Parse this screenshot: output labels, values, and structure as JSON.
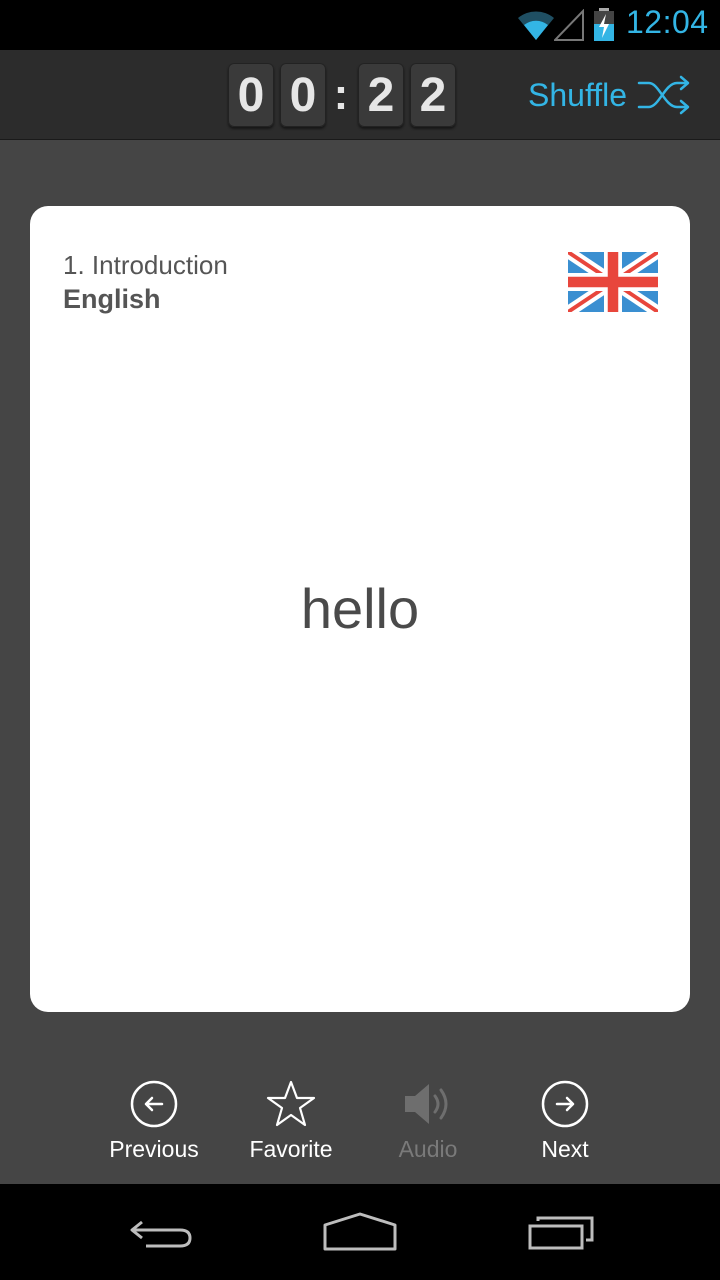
{
  "status_bar": {
    "time": "12:04",
    "clock_color": "#33b5e5"
  },
  "timer": {
    "digits": [
      "0",
      "0",
      "2",
      "2"
    ],
    "separator": ":"
  },
  "shuffle": {
    "label": "Shuffle",
    "icon": "shuffle-icon",
    "color": "#33b5e5"
  },
  "card": {
    "lesson": "1. Introduction",
    "language": "English",
    "flag": "uk-flag-icon",
    "word": "hello"
  },
  "actions": {
    "previous": {
      "label": "Previous",
      "icon": "arrow-left-circle-icon"
    },
    "favorite": {
      "label": "Favorite",
      "icon": "star-outline-icon"
    },
    "audio": {
      "label": "Audio",
      "icon": "speaker-icon",
      "enabled": false
    },
    "next": {
      "label": "Next",
      "icon": "arrow-right-circle-icon"
    }
  },
  "nav_bar": {
    "back": "back-icon",
    "home": "home-icon",
    "recents": "recents-icon"
  }
}
